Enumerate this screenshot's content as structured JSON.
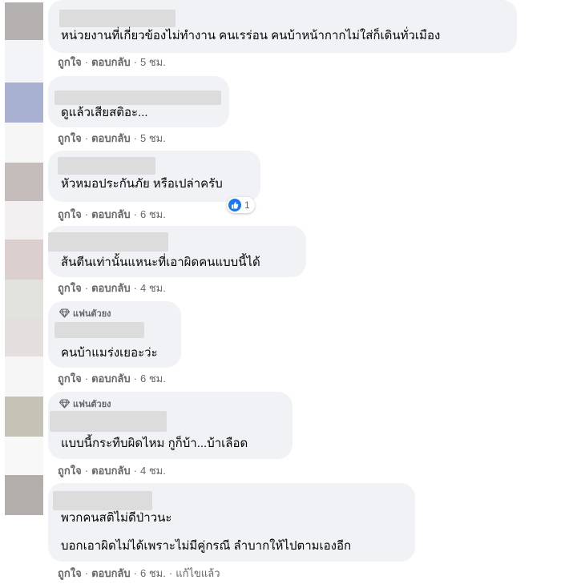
{
  "colors": {
    "bubble": "#f0f2f5",
    "action_text": "#65676b",
    "like_blue": "#1877f2"
  },
  "actions": {
    "like": "ถูกใจ",
    "reply": "ตอบกลับ",
    "edited": "แก้ไขแล้ว"
  },
  "comments": [
    {
      "lines": [
        "หน่วยงานที่เกี่ยวข้องไม่ทำงาน คนเรร่อน คนบ้าหน้ากากไม่ใส่ก็เดินทั่วเมือง"
      ],
      "time": "5 ชม.",
      "avatar_color": "#b5b1b1"
    },
    {
      "lines": [
        "ดูแล้วเสียสติอะ..."
      ],
      "time": "5 ชม.",
      "avatar_color": "#a9b1d3"
    },
    {
      "lines": [
        "หัวหมอประกันภัย หรือเปล่าครับ"
      ],
      "time": "6 ชม.",
      "avatar_color": "#c4bdbb",
      "reaction": {
        "icon": "like-icon",
        "count": "1"
      }
    },
    {
      "lines": [
        "ส้นตีนเท่านั้นแหนะที่เอาผิดคนแบบนี้ได้"
      ],
      "time": "4 ชม.",
      "avatar_color": "#dccfcf"
    },
    {
      "fan_label": "แฟนตัวยง",
      "lines": [
        "คนบ้าแมร่งเยอะว่ะ"
      ],
      "time": "6 ชม.",
      "avatar_color": "#e4dede"
    },
    {
      "fan_label": "แฟนตัวยง",
      "lines": [
        "แบบนี้กระทืบผิดไหม กูก็บ้า...บ้าเลือด"
      ],
      "time": "4 ชม.",
      "avatar_color": "#c5c2b6"
    },
    {
      "lines": [
        "พวกคนสติไม่ดีป่าวนะ",
        "บอกเอาผิดไม่ได้เพราะไม่มีคู่กรณี ลำบากให้ไปตามเองอีก"
      ],
      "time": "6 ชม.",
      "avatar_color": "#b3adab",
      "edited": true
    }
  ]
}
